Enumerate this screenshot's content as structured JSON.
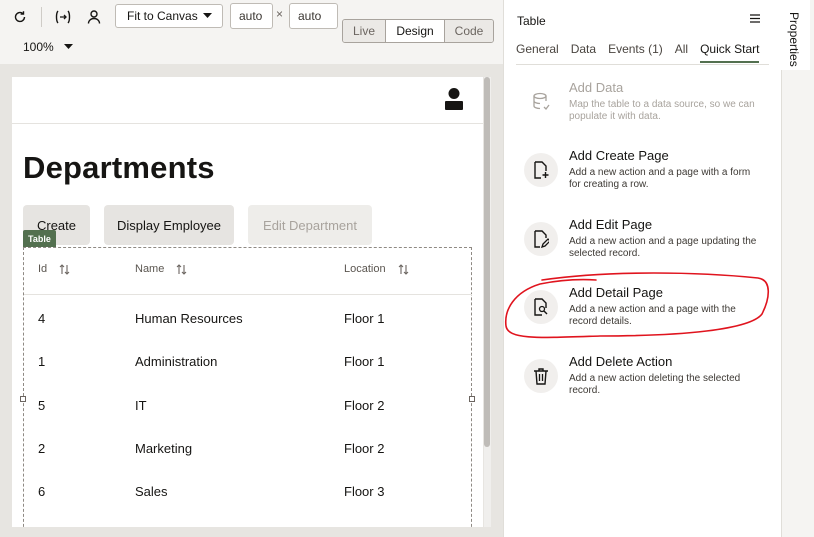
{
  "toolbar": {
    "fit_label": "Fit to Canvas",
    "width_value": "auto",
    "times": "×",
    "height_value": "auto",
    "zoom": "100%",
    "modes": [
      "Live",
      "Design",
      "Code"
    ],
    "selected_mode": "Design"
  },
  "page": {
    "title": "Departments",
    "buttons": {
      "create": "Create",
      "display_employee": "Display Employee",
      "edit_department": "Edit Department"
    },
    "table_tag": "Table",
    "columns": [
      "Id",
      "Name",
      "Location"
    ],
    "rows": [
      {
        "id": "4",
        "name": "Human Resources",
        "location": "Floor 1"
      },
      {
        "id": "1",
        "name": "Administration",
        "location": "Floor 1"
      },
      {
        "id": "5",
        "name": "IT",
        "location": "Floor 2"
      },
      {
        "id": "2",
        "name": "Marketing",
        "location": "Floor 2"
      },
      {
        "id": "6",
        "name": "Sales",
        "location": "Floor 3"
      }
    ]
  },
  "panel": {
    "title": "Table",
    "tabs": [
      "General",
      "Data",
      "Events (1)",
      "All",
      "Quick Start"
    ],
    "selected_tab": "Quick Start",
    "actions": [
      {
        "title": "Add Data",
        "desc": "Map the table to a data source, so we can populate it with data.",
        "disabled": true,
        "icon": "database-icon"
      },
      {
        "title": "Add Create Page",
        "desc": "Add a new action and a page with a form for creating a row.",
        "icon": "page-plus-icon"
      },
      {
        "title": "Add Edit Page",
        "desc": "Add a new action and a page updating the selected record.",
        "icon": "page-edit-icon"
      },
      {
        "title": "Add Detail Page",
        "desc": "Add a new action and a page with the record details.",
        "icon": "page-search-icon",
        "annotated": true
      },
      {
        "title": "Add Delete Action",
        "desc": "Add a new action deleting the selected record.",
        "icon": "trash-icon"
      }
    ]
  },
  "side_tab": "Properties",
  "colors": {
    "accent": "#53704f",
    "annotation": "#e0141e"
  }
}
